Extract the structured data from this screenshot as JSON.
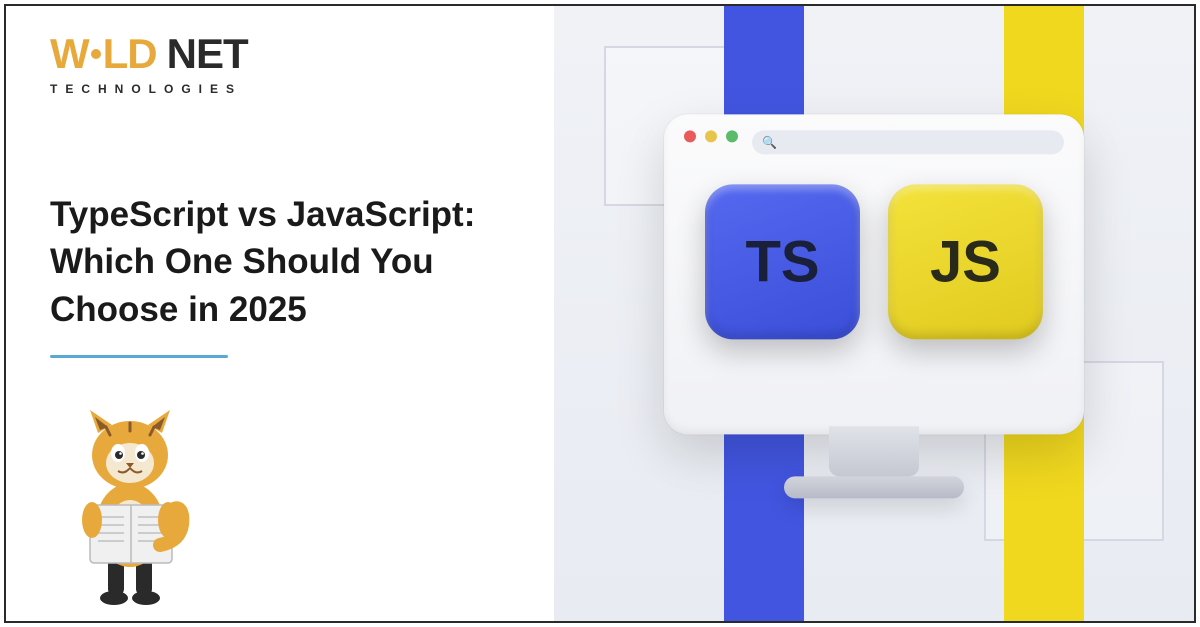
{
  "logo": {
    "part1": "W",
    "part2": "LD",
    "part3": "NET",
    "sub": "TECHNOLOGIES"
  },
  "headline": "TypeScript vs JavaScript: Which One Should You Choose in 2025",
  "tiles": {
    "ts": "TS",
    "js": "JS"
  },
  "urlbar_icon": "🔍",
  "colors": {
    "accent_blue": "#4255e0",
    "accent_yellow": "#f0d81f",
    "brand_orange": "#e8a93c"
  }
}
